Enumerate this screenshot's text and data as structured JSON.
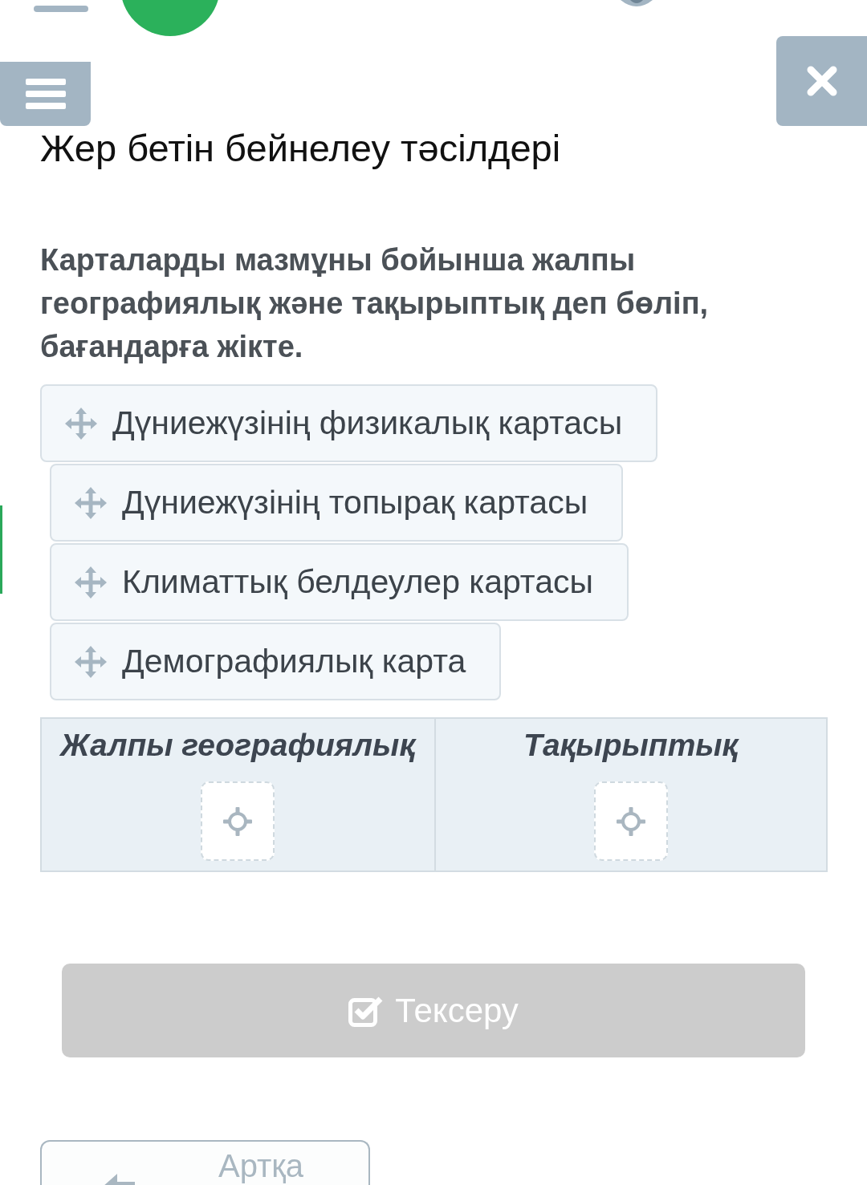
{
  "title": "Жер бетін бейнелеу тәсілдері",
  "question": "Карталарды мазмұны бойынша жалпы географиялық және тақырыптық деп бөліп, бағандарға жікте.",
  "items": [
    {
      "label": "Дүниежүзінің физикалық картасы"
    },
    {
      "label": "Дүниежүзінің топырақ картасы"
    },
    {
      "label": "Климаттық белдеулер картасы"
    },
    {
      "label": "Демографиялық карта"
    }
  ],
  "columns": [
    {
      "heading": "Жалпы географиялық"
    },
    {
      "heading": "Тақырыптық"
    }
  ],
  "check_button": {
    "label": "Тексеру",
    "disabled": true
  },
  "back_button": {
    "label": "Артқа"
  }
}
